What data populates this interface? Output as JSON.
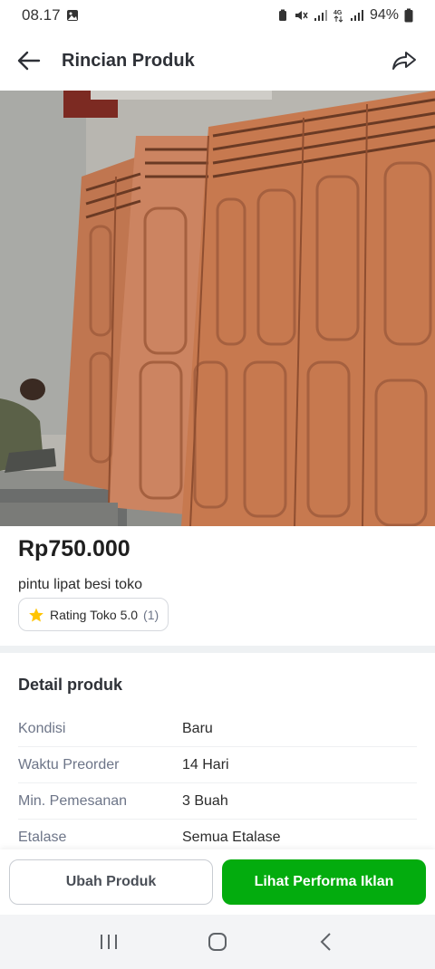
{
  "status_bar": {
    "time": "08.17",
    "battery": "94%",
    "icons": [
      "image-icon",
      "battery-saver-icon",
      "mute-icon",
      "signal-icon",
      "4g-icon",
      "signal-icon",
      "battery-icon"
    ]
  },
  "app_bar": {
    "title": "Rincian Produk",
    "back_icon": "arrow-left-icon",
    "share_icon": "share-icon"
  },
  "product": {
    "price": "Rp750.000",
    "name": "pintu lipat besi toko",
    "rating_label": "Rating Toko 5.0",
    "rating_count": "(1)",
    "colors": {
      "door": "#c7794f",
      "wall": "#b7b5ae"
    }
  },
  "detail": {
    "title": "Detail produk",
    "rows": [
      {
        "label": "Kondisi",
        "value": "Baru"
      },
      {
        "label": "Waktu Preorder",
        "value": "14 Hari"
      },
      {
        "label": "Min. Pemesanan",
        "value": "3 Buah"
      },
      {
        "label": "Etalase",
        "value": "Semua Etalase"
      }
    ]
  },
  "actions": {
    "edit_label": "Ubah Produk",
    "ads_label": "Lihat Performa Iklan",
    "primary_color": "#03ac0e"
  },
  "nav": {
    "icons": [
      "recent-apps-icon",
      "home-icon",
      "back-icon"
    ]
  }
}
